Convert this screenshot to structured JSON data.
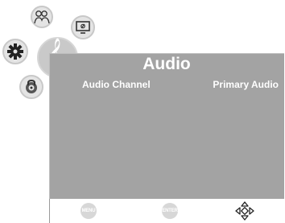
{
  "menu": {
    "title": "Audio",
    "rows": [
      {
        "label": "Audio Channel",
        "value": "Primary Audio"
      }
    ]
  },
  "icons": {
    "settings": "gear-icon",
    "people": "people-icon",
    "display": "monitor-icon",
    "audio": "music-note-icon",
    "parental": "lock-icon"
  },
  "footer": {
    "menu_label": "MENU",
    "enter_label": "ENTER",
    "nav": "direction-arrows-icon"
  },
  "colors": {
    "panel": "#a3a3a3",
    "text": "#ffffff",
    "icon_bg": "#e4e4e4",
    "active_icon_bg": "#c9c9c9"
  }
}
